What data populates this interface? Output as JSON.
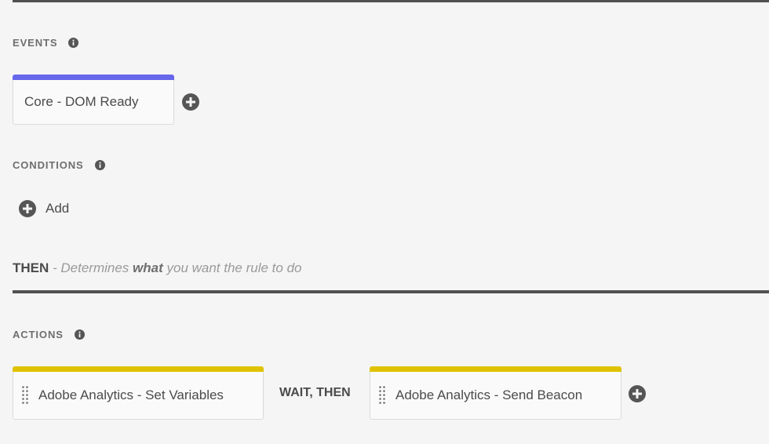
{
  "colors": {
    "event_accent": "#6767ec",
    "action_accent": "#e0c200",
    "icon_gray": "#555555"
  },
  "events": {
    "heading": "EVENTS",
    "info_icon": "info-icon",
    "items": [
      {
        "label": "Core - DOM Ready"
      }
    ],
    "add_icon": "plus-circle-icon"
  },
  "conditions": {
    "heading": "CONDITIONS",
    "info_icon": "info-icon",
    "add_label": "Add",
    "add_icon": "plus-circle-icon"
  },
  "then": {
    "word": "THEN",
    "desc_prefix": " - Determines ",
    "desc_bold": "what",
    "desc_suffix": " you want the rule to do"
  },
  "actions": {
    "heading": "ACTIONS",
    "info_icon": "info-icon",
    "items": [
      {
        "label": "Adobe Analytics - Set Variables",
        "handle_icon": "drag-handle-icon"
      },
      {
        "label": "Adobe Analytics - Send Beacon",
        "handle_icon": "drag-handle-icon"
      }
    ],
    "separator": "WAIT, THEN",
    "add_icon": "plus-circle-icon"
  }
}
